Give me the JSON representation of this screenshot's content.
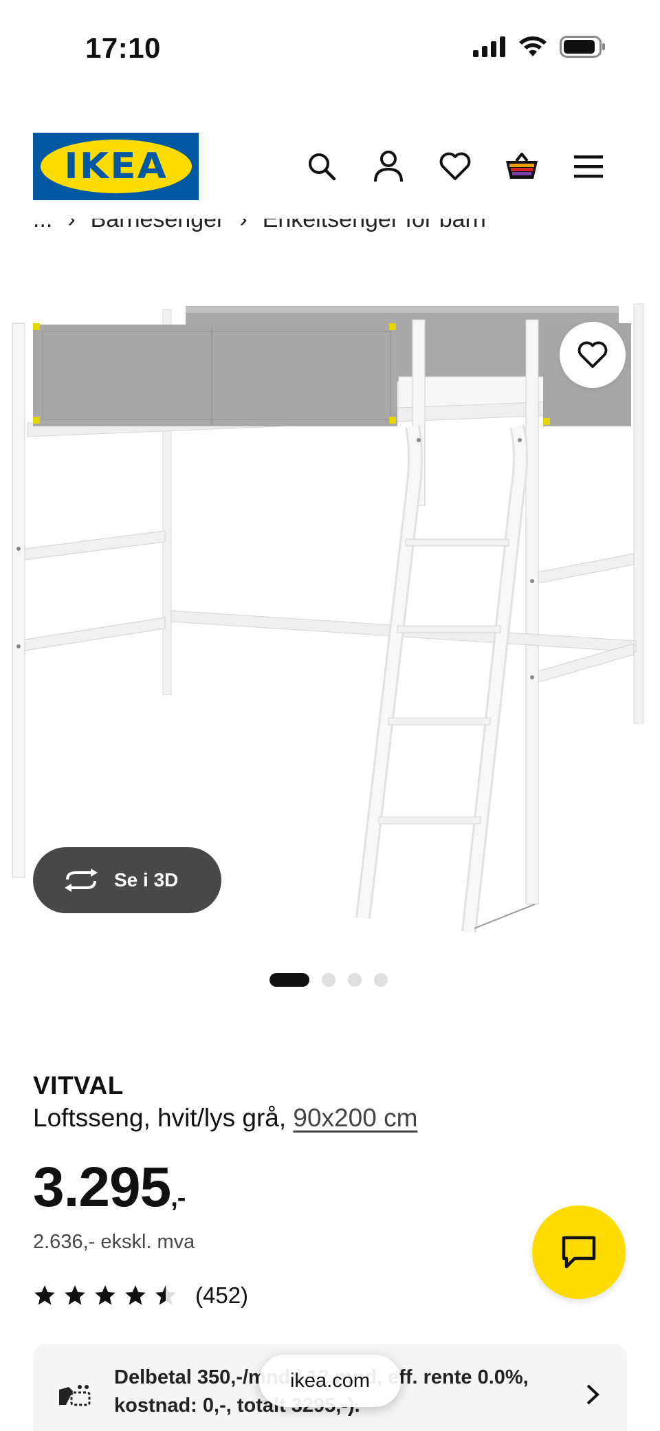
{
  "status_bar": {
    "time": "17:10",
    "icons": [
      "signal-icon",
      "wifi-icon",
      "battery-icon"
    ]
  },
  "header": {
    "logo_text": "IKEA",
    "icons": [
      "search-icon",
      "account-icon",
      "heart-icon",
      "basket-icon",
      "menu-icon"
    ]
  },
  "breadcrumb": {
    "items": [
      "...",
      "Barnesenger",
      "Enkeltsenger for barn"
    ]
  },
  "gallery": {
    "view3d_label": "Se i 3D",
    "slide_count": 4,
    "active_index": 0
  },
  "product": {
    "name": "VITVAL",
    "description": "Loftsseng, hvit/lys grå, ",
    "size_link": "90x200 cm",
    "price": "3.295",
    "price_suffix": ",-",
    "price_ex_vat": "2.636,- ekskl. mva",
    "rating_value": 4.5,
    "rating_count": "(452)"
  },
  "finance": {
    "text": "Delbetal 350,-/mnd i 12 mnd, eff. rente 0.0%, kostnad: 0,-, totalt 3295,-)."
  },
  "browser": {
    "url": "ikea.com"
  },
  "colors": {
    "ikea_blue": "#0058a3",
    "ikea_yellow": "#ffdb00",
    "pill_dark": "#484848"
  }
}
